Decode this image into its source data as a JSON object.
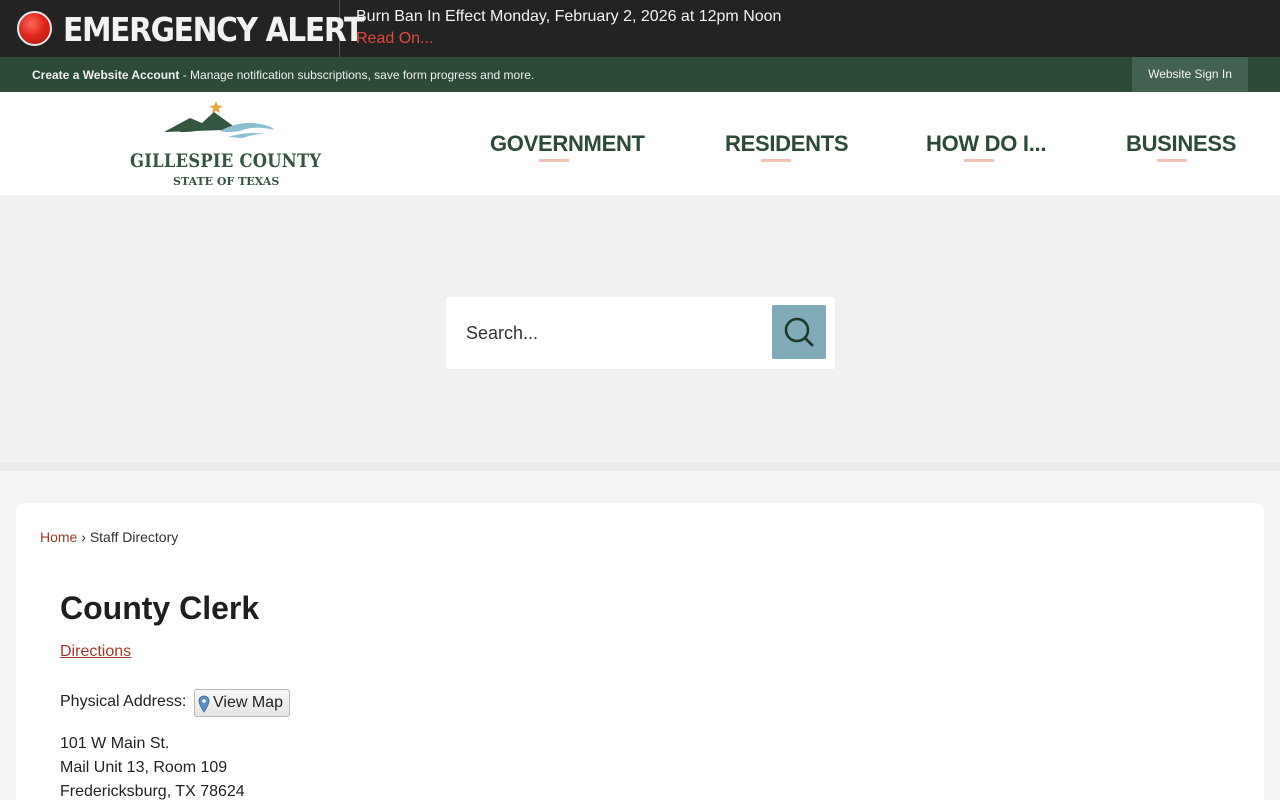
{
  "alert": {
    "title": "EMERGENCY ALERT",
    "message": "Burn Ban In Effect Monday, February 2, 2026 at 12pm Noon",
    "link": "Read On..."
  },
  "account_bar": {
    "create_account": "Create a Website Account",
    "description": " - Manage notification subscriptions, save form progress and more.",
    "sign_in": "Website Sign In"
  },
  "logo": {
    "name": "GILLESPIE COUNTY",
    "subtitle": "STATE OF TEXAS"
  },
  "nav": {
    "items": [
      "GOVERNMENT",
      "RESIDENTS",
      "HOW DO I...",
      "BUSINESS"
    ]
  },
  "search": {
    "placeholder": "Search..."
  },
  "breadcrumb": {
    "home": "Home",
    "separator": "›",
    "current": "Staff Directory"
  },
  "page": {
    "title": "County Clerk",
    "directions": "Directions",
    "physical_label": "Physical Address:",
    "view_map": "View Map",
    "address": [
      "101 W Main St.",
      "Mail Unit 13, Room 109",
      "Fredericksburg, TX 78624"
    ]
  },
  "colors": {
    "alert_bg": "#232323",
    "account_bar_bg": "#2c4a36",
    "nav_text": "#2c4a36",
    "link_red": "#a13b2a",
    "search_button": "#82abba"
  }
}
